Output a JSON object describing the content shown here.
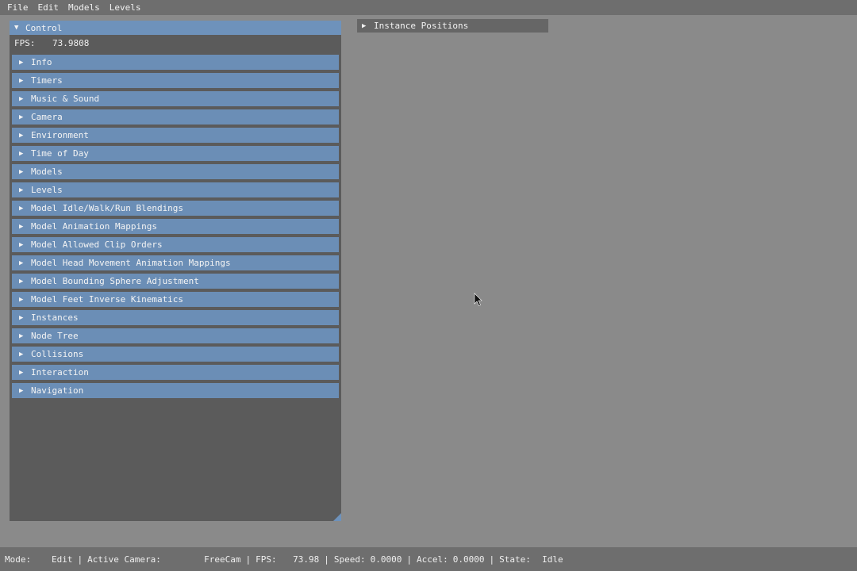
{
  "menubar": {
    "items": [
      "File",
      "Edit",
      "Models",
      "Levels"
    ]
  },
  "control": {
    "title": "Control",
    "fps_label": "FPS:",
    "fps_value": "73.9808",
    "sections": [
      "Info",
      "Timers",
      "Music & Sound",
      "Camera",
      "Environment",
      "Time of Day",
      "Models",
      "Levels",
      "Model Idle/Walk/Run Blendings",
      "Model Animation Mappings",
      "Model Allowed Clip Orders",
      "Model Head Movement Animation Mappings",
      "Model Bounding Sphere Adjustment",
      "Model Feet Inverse Kinematics",
      "Instances",
      "Node Tree",
      "Collisions",
      "Interaction",
      "Navigation"
    ]
  },
  "instance_window": {
    "title": "Instance Positions"
  },
  "statusbar": {
    "mode_label": "Mode:",
    "mode_value": "Edit",
    "camera_label": "Active Camera:",
    "camera_value": "FreeCam",
    "fps_label": "FPS:",
    "fps_value": "73.98",
    "speed_label": "Speed:",
    "speed_value": "0.0000",
    "accel_label": "Accel:",
    "accel_value": "0.0000",
    "state_label": "State:",
    "state_value": "Idle",
    "separator": "|"
  },
  "colors": {
    "background": "#8a8a8a",
    "panel": "#5b5b5b",
    "header_blue": "#6b8eb6",
    "bar": "#6e6e6e"
  }
}
